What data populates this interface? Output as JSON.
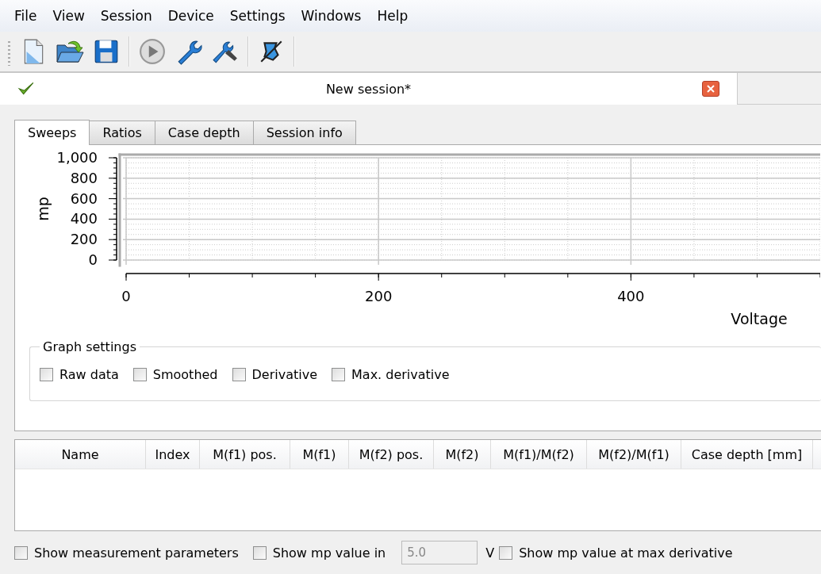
{
  "menu": [
    "File",
    "View",
    "Session",
    "Device",
    "Settings",
    "Windows",
    "Help"
  ],
  "toolbar": [
    {
      "kind": "new"
    },
    {
      "kind": "open"
    },
    {
      "kind": "save"
    },
    {
      "kind": "sep"
    },
    {
      "kind": "play"
    },
    {
      "kind": "wrench"
    },
    {
      "kind": "tools"
    },
    {
      "kind": "sep"
    },
    {
      "kind": "probe"
    },
    {
      "kind": "sep"
    }
  ],
  "document": {
    "title": "New session*",
    "saved": true
  },
  "tabs": [
    {
      "label": "Sweeps",
      "selected": true
    },
    {
      "label": "Ratios",
      "selected": false
    },
    {
      "label": "Case depth",
      "selected": false
    },
    {
      "label": "Session info",
      "selected": false
    }
  ],
  "chart": {
    "chart_data": {
      "type": "line",
      "grid": true,
      "xlabel": "Voltage",
      "ylabel": "mp",
      "xlim": [
        0,
        550
      ],
      "ylim": [
        0,
        1000
      ],
      "xticks": [
        0,
        200,
        400
      ],
      "yticks": [
        {
          "value": 0,
          "label": "0"
        },
        {
          "value": 200,
          "label": "200"
        },
        {
          "value": 400,
          "label": "400"
        },
        {
          "value": 600,
          "label": "600"
        },
        {
          "value": 800,
          "label": "800"
        },
        {
          "value": 1000,
          "label": "1,000"
        }
      ]
    }
  },
  "graph_settings": {
    "title": "Graph settings",
    "options": [
      {
        "label": "Raw data",
        "checked": false
      },
      {
        "label": "Smoothed",
        "checked": false
      },
      {
        "label": "Derivative",
        "checked": false
      },
      {
        "label": "Max. derivative",
        "checked": false
      }
    ]
  },
  "table": {
    "columns": [
      "Name",
      "Index",
      "M(f1) pos.",
      "M(f1)",
      "M(f2) pos.",
      "M(f2)",
      "M(f1)/M(f2)",
      "M(f2)/M(f1)",
      "Case depth [mm]"
    ]
  },
  "footer": {
    "show_params": {
      "label": "Show measurement parameters",
      "checked": false
    },
    "show_mp": {
      "label": "Show mp value in",
      "checked": false
    },
    "voltage": {
      "value": "5.0",
      "disabled": true
    },
    "unit": "V",
    "show_max": {
      "label": "Show mp value at max derivative",
      "checked": false
    }
  }
}
